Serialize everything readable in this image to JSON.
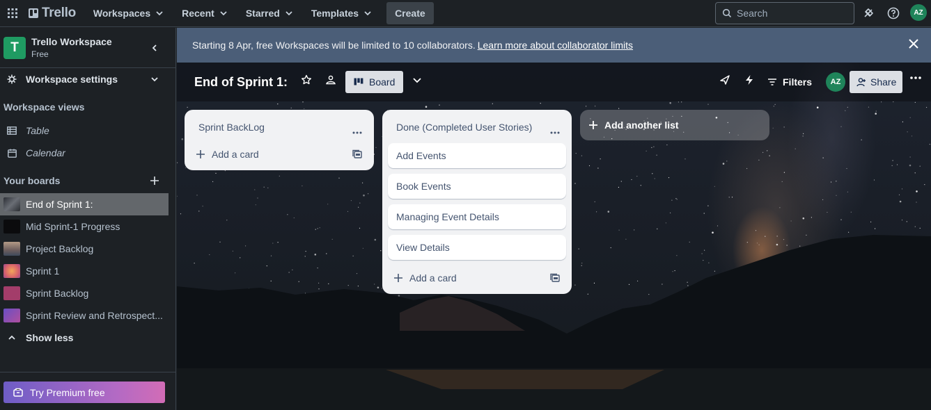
{
  "topbar": {
    "logo_text": "Trello",
    "nav": [
      {
        "label": "Workspaces"
      },
      {
        "label": "Recent"
      },
      {
        "label": "Starred"
      },
      {
        "label": "Templates"
      }
    ],
    "create_label": "Create",
    "search_placeholder": "Search",
    "avatar_initials": "AZ"
  },
  "sidebar": {
    "workspace_badge": "T",
    "workspace_name": "Trello Workspace",
    "workspace_plan": "Free",
    "settings_label": "Workspace settings",
    "views_heading": "Workspace views",
    "views": [
      {
        "label": "Table",
        "icon": "table-icon"
      },
      {
        "label": "Calendar",
        "icon": "calendar-icon"
      }
    ],
    "boards_heading": "Your boards",
    "boards": [
      {
        "label": "End of Sprint 1:",
        "thumb": "#4a4f58",
        "active": true
      },
      {
        "label": "Mid Sprint-1 Progress",
        "thumb": "#0b0b0d"
      },
      {
        "label": "Project Backlog",
        "thumb": "#8a7a6e"
      },
      {
        "label": "Sprint 1",
        "thumb": "#d9636a"
      },
      {
        "label": "Sprint Backlog",
        "thumb": "#a33d6a"
      },
      {
        "label": "Sprint Review and Retrospect...",
        "thumb": "#7a4fb0"
      }
    ],
    "show_less_label": "Show less",
    "premium_label": "Try Premium free"
  },
  "banner": {
    "text": "Starting 8 Apr, free Workspaces will be limited to 10 collaborators.",
    "link": "Learn more about collaborator limits"
  },
  "board": {
    "title": "End of Sprint 1:",
    "view_label": "Board",
    "filters_label": "Filters",
    "avatar_initials": "AZ",
    "share_label": "Share"
  },
  "lists": [
    {
      "title": "Sprint BackLog",
      "cards": [],
      "add_card": "Add a card"
    },
    {
      "title": "Done (Completed User Stories)",
      "cards": [
        "Add Events",
        "Book Events",
        "Managing Event Details",
        "View Details"
      ],
      "add_card": "Add a card"
    }
  ],
  "add_list_label": "Add another list",
  "colors": {
    "workspace_badge": "#1f9b62",
    "banner": "#4b5e78",
    "avatar": "#1f845a",
    "premium_gradient_start": "#6e5dc6",
    "premium_gradient_end": "#d26cb6"
  }
}
